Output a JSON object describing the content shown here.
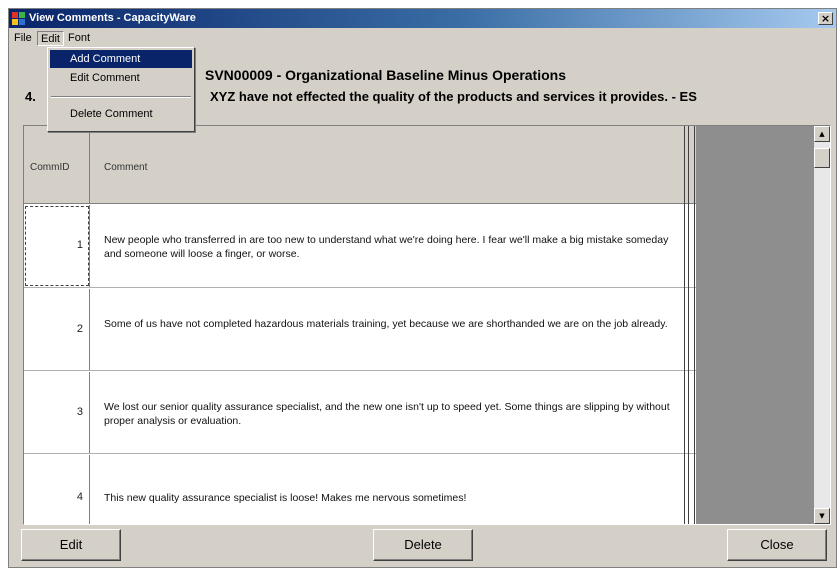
{
  "window": {
    "title": "View Comments - CapacityWare",
    "close_glyph": "×"
  },
  "menu": {
    "file": "File",
    "edit": "Edit",
    "font": "Font",
    "edit_items": [
      "Add Comment",
      "Edit Comment",
      "Delete Comment"
    ],
    "highlighted_index": 0
  },
  "heading": {
    "line1": "SVN00009  - Organizational Baseline Minus Operations",
    "line2_prefix": "4.",
    "line2_rest": "XYZ have not effected the quality of the products and services it provides.  - ES"
  },
  "grid": {
    "columns": [
      "CommID",
      "Comment"
    ],
    "rows": [
      {
        "id": "1",
        "comment": "New people who transferred in are too new to understand what we're doing here.  I fear we'll make a big mistake someday and someone will loose a finger, or worse."
      },
      {
        "id": "2",
        "comment": "Some of us have not completed hazardous materials training, yet because we are shorthanded we are on the job already."
      },
      {
        "id": "3",
        "comment": "We lost our senior quality assurance specialist, and the new one isn't up to speed yet.  Some things are slipping by without proper analysis or evaluation."
      },
      {
        "id": "4",
        "comment": "This new quality assurance specialist is loose!  Makes me nervous sometimes!"
      }
    ]
  },
  "buttons": {
    "edit": "Edit",
    "delete": "Delete",
    "close": "Close"
  },
  "icons": {
    "app": "capacityware-app-icon",
    "scroll_up": "scroll-up-arrow-icon",
    "scroll_down": "scroll-down-arrow-icon"
  }
}
